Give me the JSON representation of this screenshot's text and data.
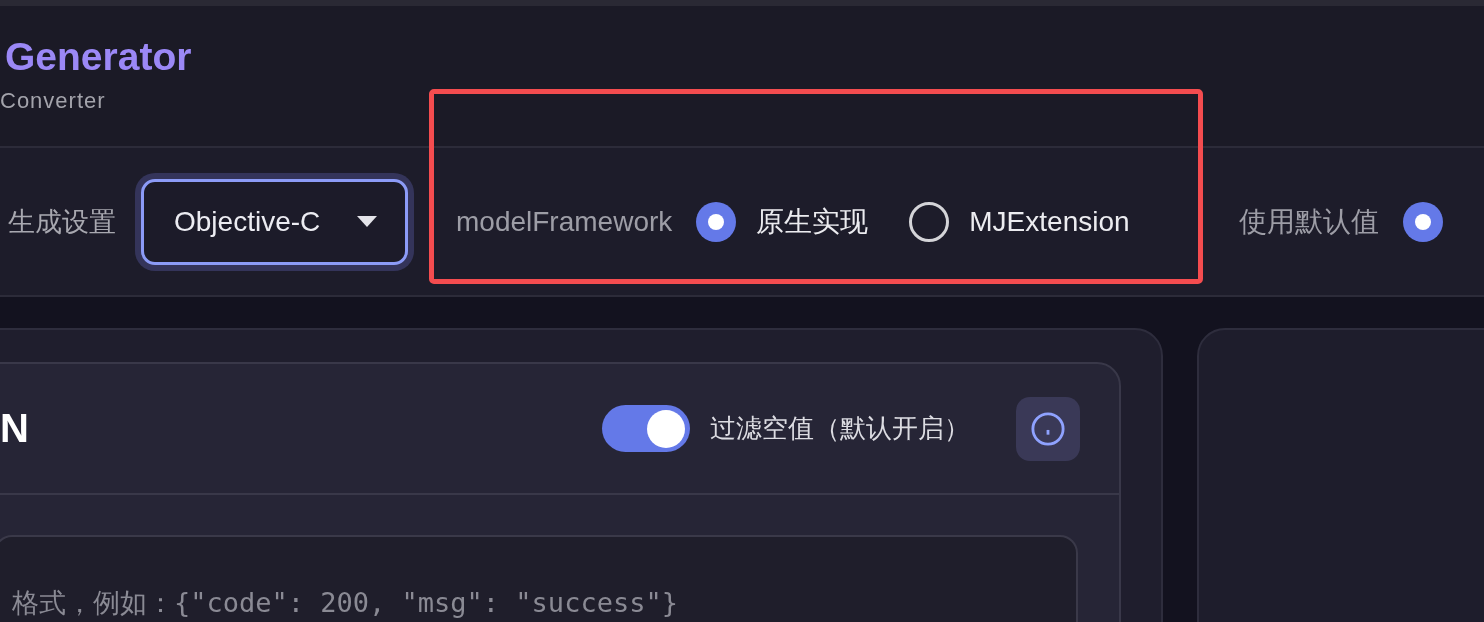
{
  "header": {
    "title": "Generator",
    "subtitle": "Converter"
  },
  "settings": {
    "label": "生成设置",
    "language_select": {
      "value": "Objective-C",
      "focused": true
    },
    "groups": [
      {
        "label": "modelFramework",
        "highlighted": true,
        "options": [
          {
            "label": "原生实现",
            "selected": true
          },
          {
            "label": "MJExtension",
            "selected": false
          }
        ]
      },
      {
        "label": "使用默认值",
        "highlighted": false,
        "options": [
          {
            "selected": true
          }
        ]
      }
    ]
  },
  "input_panel": {
    "title": "N",
    "filter_toggle": {
      "label": "过滤空值（默认开启）",
      "on": true
    },
    "editor": {
      "placeholder": "格式，例如：{\"code\": 200, \"msg\": \"success\"}"
    }
  }
}
